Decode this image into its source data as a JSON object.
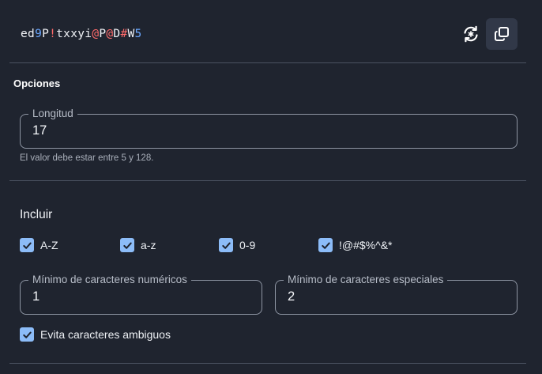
{
  "password": {
    "segments": [
      {
        "text": "ed",
        "kind": "letter"
      },
      {
        "text": "9",
        "kind": "number"
      },
      {
        "text": "P",
        "kind": "letter"
      },
      {
        "text": "!",
        "kind": "special"
      },
      {
        "text": "txxyi",
        "kind": "letter"
      },
      {
        "text": "@",
        "kind": "special"
      },
      {
        "text": "P",
        "kind": "letter"
      },
      {
        "text": "@",
        "kind": "special"
      },
      {
        "text": "D",
        "kind": "letter"
      },
      {
        "text": "#",
        "kind": "special"
      },
      {
        "text": "W",
        "kind": "letter"
      },
      {
        "text": "5",
        "kind": "number"
      }
    ],
    "regenerate_icon": "refresh-icon",
    "copy_icon": "copy-icon"
  },
  "options": {
    "title": "Opciones",
    "length": {
      "label": "Longitud",
      "value": "17",
      "hint": "El valor debe estar entre 5 y 128."
    },
    "include": {
      "title": "Incluir",
      "uppercase": {
        "label": "A-Z",
        "checked": true
      },
      "lowercase": {
        "label": "a-z",
        "checked": true
      },
      "numbers": {
        "label": "0-9",
        "checked": true
      },
      "special": {
        "label": "!@#$%^&*",
        "checked": true
      }
    },
    "min_numbers": {
      "label": "Mínimo de caracteres numéricos",
      "value": "1"
    },
    "min_special": {
      "label": "Mínimo de caracteres especiales",
      "value": "2"
    },
    "avoid_ambiguous": {
      "label": "Evita caracteres ambiguos",
      "checked": true
    }
  },
  "colors": {
    "background": "#1f242f",
    "checkbox": "#8cbcf8",
    "number_char": "#6aa7ff",
    "special_char": "#ff6b6b"
  }
}
